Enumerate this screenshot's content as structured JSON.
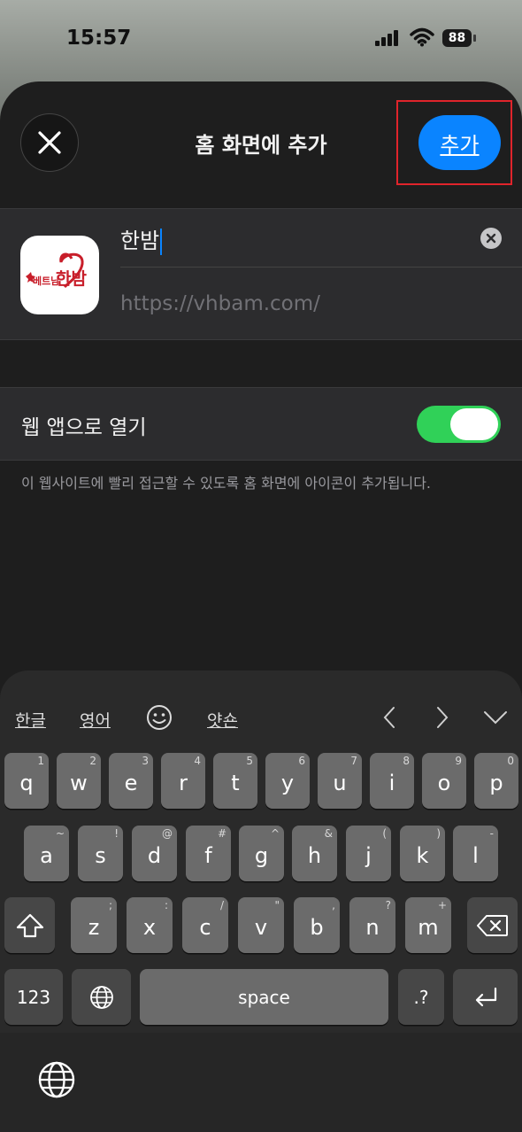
{
  "status_bar": {
    "time": "15:57",
    "battery": "88"
  },
  "header": {
    "title": "홈 화면에 추가",
    "add_label": "추가"
  },
  "app": {
    "name": "한밤",
    "url": "https://vhbam.com/",
    "icon_text_small": "베트남",
    "icon_text_big": "한밤"
  },
  "toggle": {
    "label": "웹 앱으로 열기",
    "on": true
  },
  "footnote": "이 웹사이트에 빨리 접근할 수 있도록 홈 화면에 아이콘이 추가됩니다.",
  "keyboard": {
    "suggestions": [
      "한글",
      "영어",
      "얏숀"
    ],
    "row1": [
      {
        "k": "q",
        "h": "1"
      },
      {
        "k": "w",
        "h": "2"
      },
      {
        "k": "e",
        "h": "3"
      },
      {
        "k": "r",
        "h": "4"
      },
      {
        "k": "t",
        "h": "5"
      },
      {
        "k": "y",
        "h": "6"
      },
      {
        "k": "u",
        "h": "7"
      },
      {
        "k": "i",
        "h": "8"
      },
      {
        "k": "o",
        "h": "9"
      },
      {
        "k": "p",
        "h": "0"
      }
    ],
    "row2": [
      {
        "k": "a",
        "h": "~"
      },
      {
        "k": "s",
        "h": "!"
      },
      {
        "k": "d",
        "h": "@"
      },
      {
        "k": "f",
        "h": "#"
      },
      {
        "k": "g",
        "h": "^"
      },
      {
        "k": "h",
        "h": "&"
      },
      {
        "k": "j",
        "h": "("
      },
      {
        "k": "k",
        "h": ")"
      },
      {
        "k": "l",
        "h": "-"
      }
    ],
    "row3": [
      {
        "k": "z",
        "h": ";"
      },
      {
        "k": "x",
        "h": ":"
      },
      {
        "k": "c",
        "h": "/"
      },
      {
        "k": "v",
        "h": "\""
      },
      {
        "k": "b",
        "h": ","
      },
      {
        "k": "n",
        "h": "?"
      },
      {
        "k": "m",
        "h": "+"
      }
    ],
    "numbers_label": "123",
    "space_label": "space",
    "punct_label": ".?"
  },
  "colors": {
    "accent": "#0a84ff",
    "toggle_on": "#30d158",
    "highlight": "#e0242b"
  }
}
